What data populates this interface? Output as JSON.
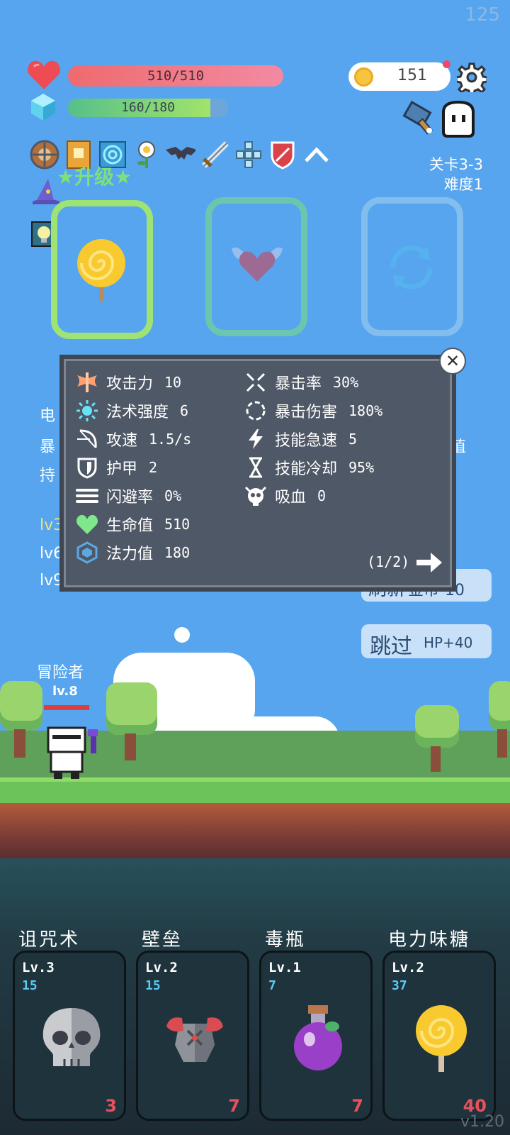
{
  "fps": "125",
  "hud": {
    "hp_text": "510/510",
    "mp_text": "160/180",
    "mp_fraction": 0.889,
    "coins": "151",
    "stage": "关卡3-3",
    "difficulty": "难度1",
    "upgrade_label": "★升级★"
  },
  "relics": [
    "shield-icon",
    "book-icon",
    "spiral-tile-icon",
    "flower-icon",
    "bat-icon",
    "sword-icon",
    "gem-cluster-icon",
    "crest-shield-icon",
    "chevron-up-icon"
  ],
  "background_text": {
    "line1": "电",
    "line2": "暴",
    "line3": "持",
    "line4_right": "值",
    "lv_a": "lv3",
    "lv_b": "lv6",
    "lv_c": "lv9"
  },
  "buttons": {
    "refresh_label": "刷新",
    "refresh_cost": "金币-10",
    "skip_label": "跳过",
    "skip_bonus": "HP+40"
  },
  "stats": {
    "left": [
      {
        "icon": "axe-icon",
        "label": "攻击力",
        "value": "10"
      },
      {
        "icon": "sun-icon",
        "label": "法术强度",
        "value": "6"
      },
      {
        "icon": "bow-icon",
        "label": "攻速",
        "value": "1.5/s"
      },
      {
        "icon": "armor-shield-icon",
        "label": "护甲",
        "value": "2"
      },
      {
        "icon": "dodge-lines-icon",
        "label": "闪避率",
        "value": "0%"
      },
      {
        "icon": "heart-icon",
        "label": "生命值",
        "value": "510"
      },
      {
        "icon": "mana-gem-icon",
        "label": "法力值",
        "value": "180"
      }
    ],
    "right": [
      {
        "icon": "crit-cross-icon",
        "label": "暴击率",
        "value": "30%"
      },
      {
        "icon": "crit-ring-icon",
        "label": "暴击伤害",
        "value": "180%"
      },
      {
        "icon": "lightning-icon",
        "label": "技能急速",
        "value": "5"
      },
      {
        "icon": "hourglass-icon",
        "label": "技能冷却",
        "value": "95%"
      },
      {
        "icon": "vampire-skull-icon",
        "label": "吸血",
        "value": "0"
      }
    ],
    "page": "(1/2)"
  },
  "hero": {
    "name": "冒险者",
    "level": "lv.8"
  },
  "cards": [
    {
      "title": "诅咒术",
      "level": "Lv.3",
      "cost": "15",
      "count": "3",
      "art": "skull-icon"
    },
    {
      "title": "壁垒",
      "level": "Lv.2",
      "cost": "15",
      "count": "7",
      "art": "armor-icon"
    },
    {
      "title": "毒瓶",
      "level": "Lv.1",
      "cost": "7",
      "count": "7",
      "art": "poison-bottle-icon"
    },
    {
      "title": "电力味糖",
      "level": "Lv.2",
      "cost": "37",
      "count": "40",
      "art": "lollipop-icon"
    }
  ],
  "version": "v1.20",
  "colors": {
    "sky": "#56a5ee",
    "hp": "#ee6b6e",
    "mp": "#a2e36a",
    "panel": "#4f5866",
    "card": "#1f333d",
    "cost": "#5cc9f3",
    "count": "#e8505b"
  }
}
